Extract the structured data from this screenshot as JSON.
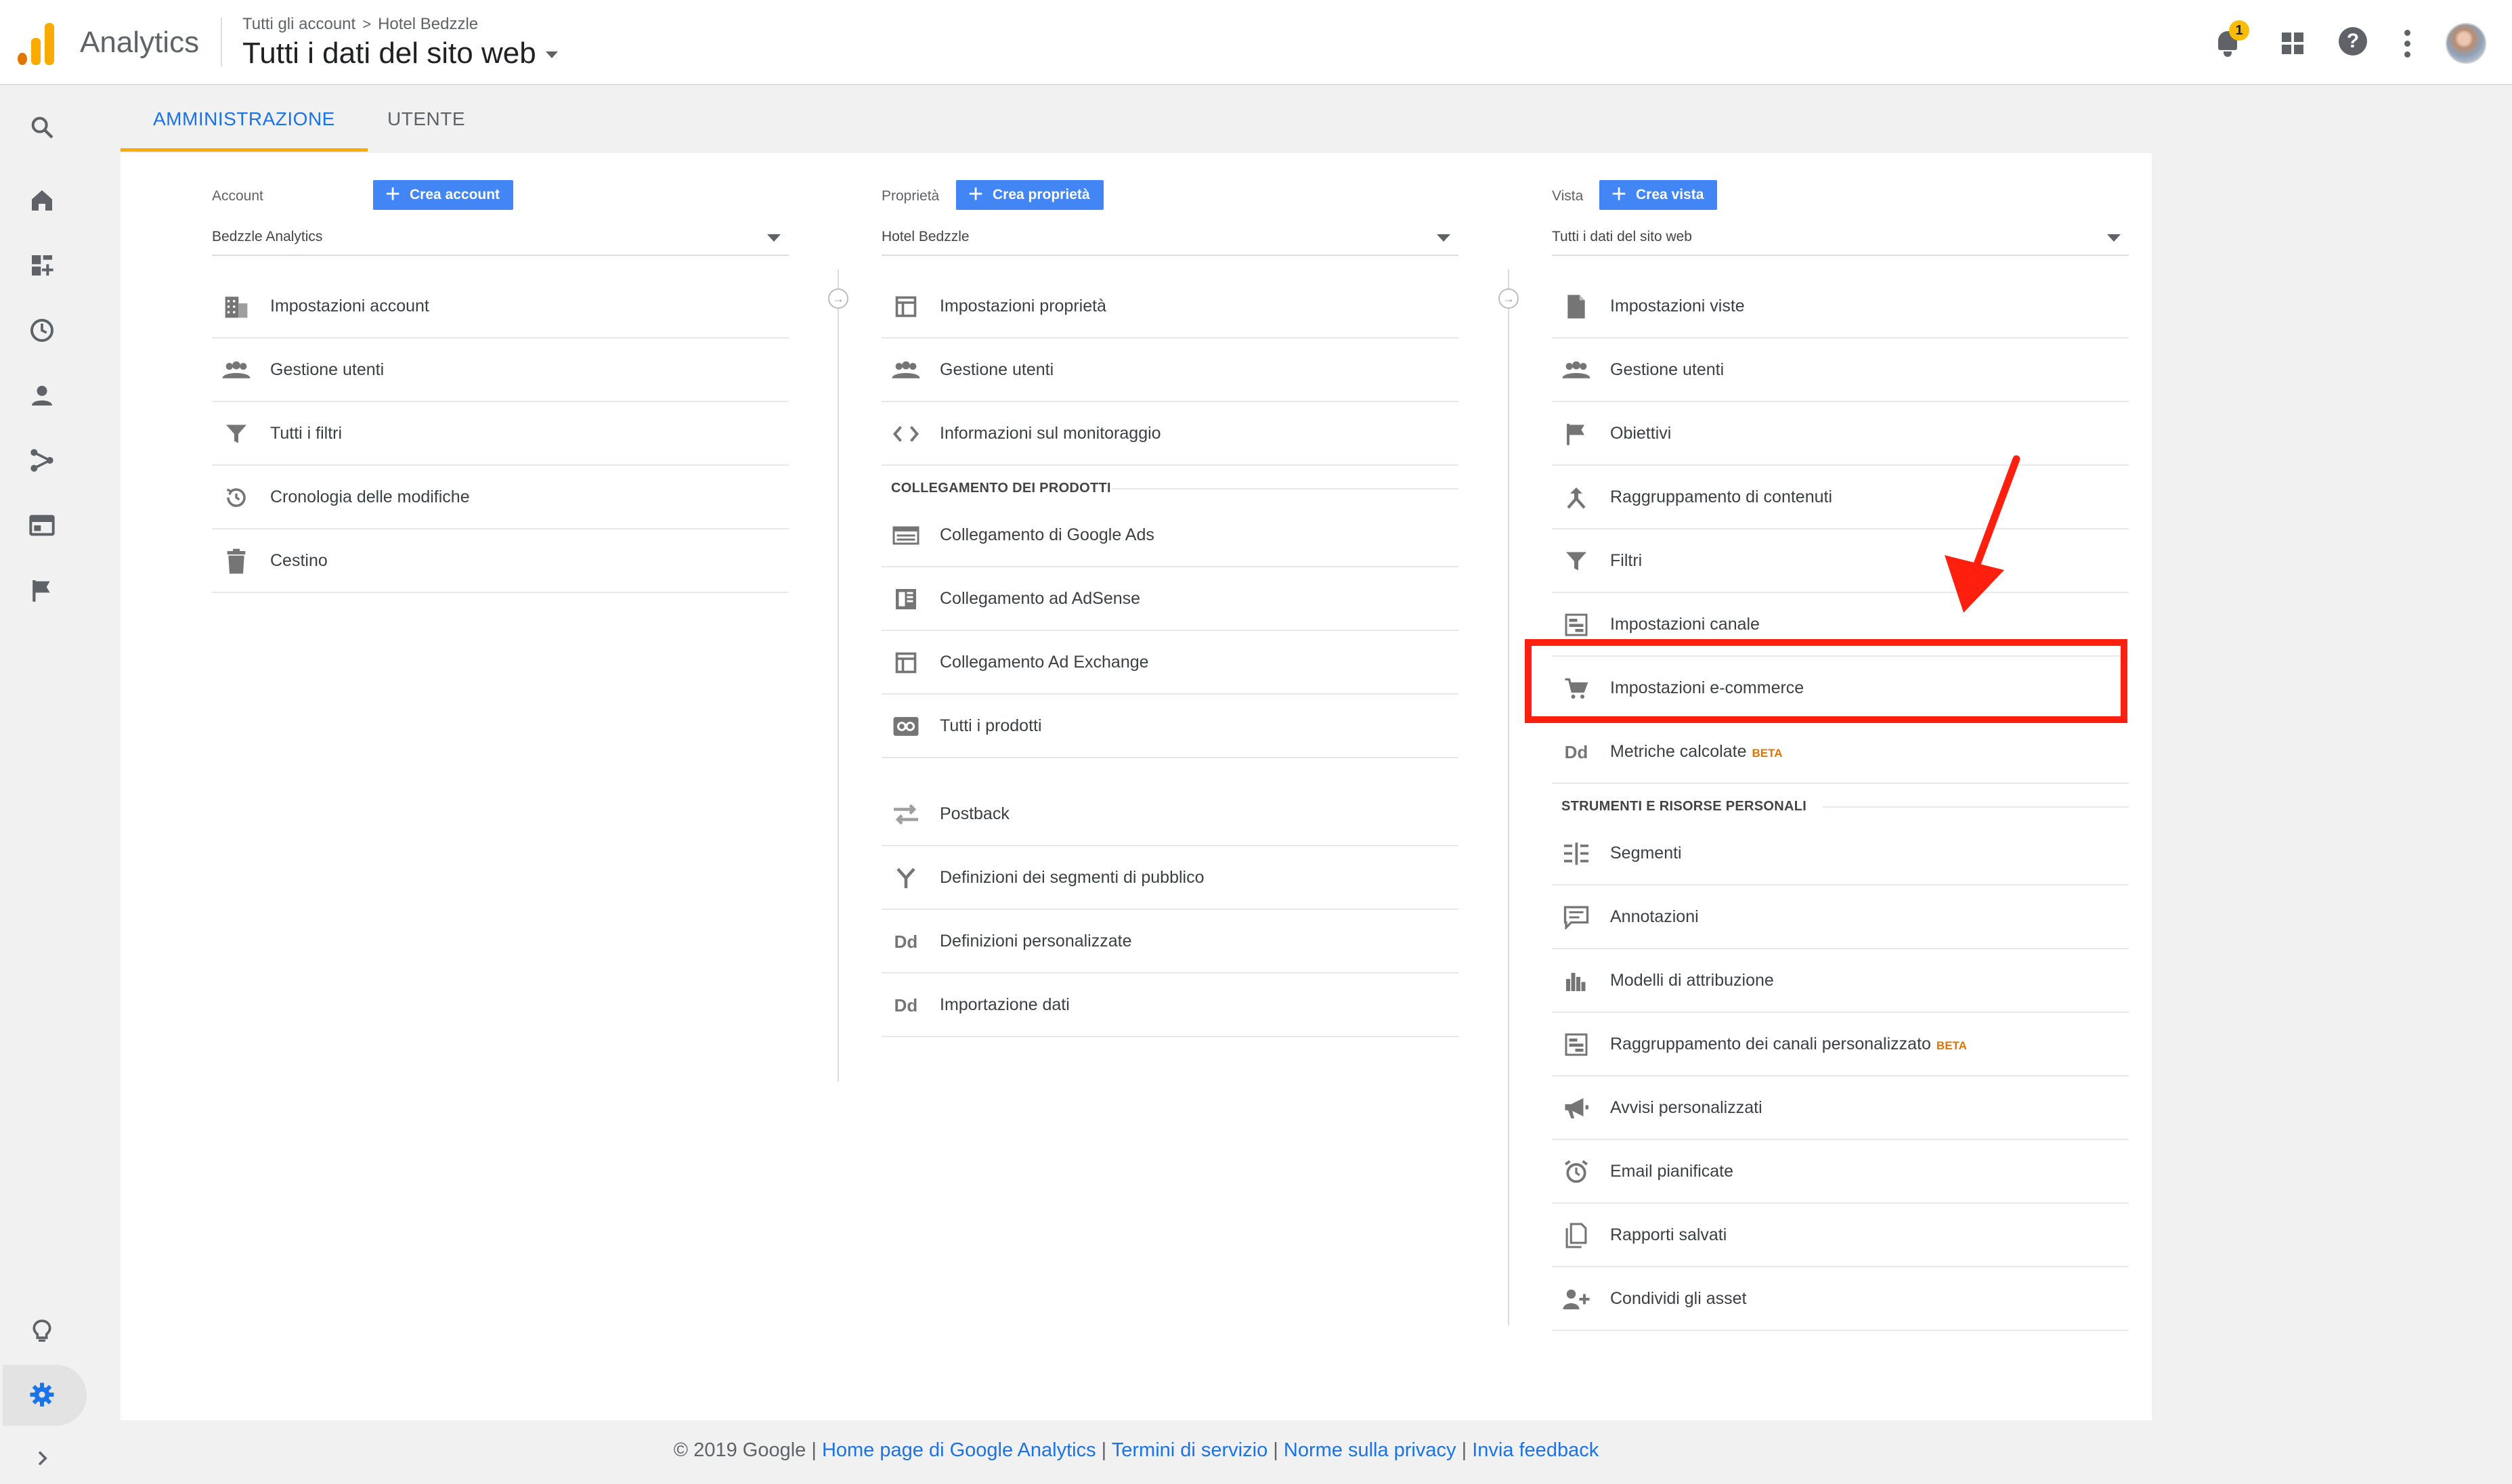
{
  "header": {
    "app_name": "Analytics",
    "breadcrumb": [
      "Tutti gli account",
      "Hotel Bedzzle"
    ],
    "breadcrumb_sep": ">",
    "view_title": "Tutti i dati del sito web",
    "notification_count": "1",
    "help_glyph": "?"
  },
  "tabs": [
    {
      "label": "AMMINISTRAZIONE",
      "active": true
    },
    {
      "label": "UTENTE",
      "active": false
    }
  ],
  "columns": {
    "account": {
      "label": "Account",
      "create_label": "Crea account",
      "selected": "Bedzzle Analytics",
      "items": [
        {
          "label": "Impostazioni account",
          "icon": "building-icon"
        },
        {
          "label": "Gestione utenti",
          "icon": "people-icon"
        },
        {
          "label": "Tutti i filtri",
          "icon": "filter-icon"
        },
        {
          "label": "Cronologia delle modifiche",
          "icon": "history-icon"
        },
        {
          "label": "Cestino",
          "icon": "trash-icon"
        }
      ]
    },
    "property": {
      "label": "Proprietà",
      "create_label": "Crea proprietà",
      "selected": "Hotel Bedzzle",
      "items": [
        {
          "label": "Impostazioni proprietà",
          "icon": "window-icon"
        },
        {
          "label": "Gestione utenti",
          "icon": "people-icon"
        },
        {
          "label": "Informazioni sul monitoraggio",
          "icon": "code-icon"
        }
      ],
      "section_title": "COLLEGAMENTO DEI PRODOTTI",
      "product_items": [
        {
          "label": "Collegamento di Google Ads",
          "icon": "ads-icon"
        },
        {
          "label": "Collegamento ad AdSense",
          "icon": "adsense-icon"
        },
        {
          "label": "Collegamento Ad Exchange",
          "icon": "window-icon"
        },
        {
          "label": "Tutti i prodotti",
          "icon": "link-box-icon"
        }
      ],
      "other_items": [
        {
          "label": "Postback",
          "icon": "swap-icon"
        },
        {
          "label": "Definizioni dei segmenti di pubblico",
          "icon": "fork-icon"
        },
        {
          "label": "Definizioni personalizzate",
          "icon": "dd-icon",
          "glyph": "Dd"
        },
        {
          "label": "Importazione dati",
          "icon": "dd-icon",
          "glyph": "Dd"
        }
      ]
    },
    "view": {
      "label": "Vista",
      "create_label": "Crea vista",
      "selected": "Tutti i dati del sito web",
      "items": [
        {
          "label": "Impostazioni viste",
          "icon": "document-icon"
        },
        {
          "label": "Gestione utenti",
          "icon": "people-icon"
        },
        {
          "label": "Obiettivi",
          "icon": "flag-icon"
        },
        {
          "label": "Raggruppamento di contenuti",
          "icon": "merge-icon"
        },
        {
          "label": "Filtri",
          "icon": "filter-icon"
        },
        {
          "label": "Impostazioni canale",
          "icon": "channel-icon"
        },
        {
          "label": "Impostazioni e-commerce",
          "icon": "cart-icon"
        },
        {
          "label": "Metriche calcolate",
          "icon": "dd-icon",
          "glyph": "Dd",
          "badge": "BETA"
        }
      ],
      "section_title": "STRUMENTI E RISORSE PERSONALI",
      "tool_items": [
        {
          "label": "Segmenti",
          "icon": "segments-icon"
        },
        {
          "label": "Annotazioni",
          "icon": "comment-icon"
        },
        {
          "label": "Modelli di attribuzione",
          "icon": "bar-chart-icon"
        },
        {
          "label": "Raggruppamento dei canali personalizzato",
          "icon": "channel-icon",
          "badge": "BETA"
        },
        {
          "label": "Avvisi personalizzati",
          "icon": "megaphone-icon"
        },
        {
          "label": "Email pianificate",
          "icon": "alarm-icon"
        },
        {
          "label": "Rapporti salvati",
          "icon": "files-icon"
        },
        {
          "label": "Condividi gli asset",
          "icon": "person-add-icon"
        }
      ]
    }
  },
  "footer": {
    "copyright": "© 2019 Google |",
    "links": [
      "Home page di Google Analytics",
      "Termini di servizio",
      "Norme sulla privacy",
      "Invia feedback"
    ],
    "sep": "|"
  },
  "colors": {
    "accent_blue": "#1a73e8",
    "button_blue": "#4285f4",
    "tab_underline": "#f9ab00",
    "highlight_red": "#ff1f0e"
  }
}
